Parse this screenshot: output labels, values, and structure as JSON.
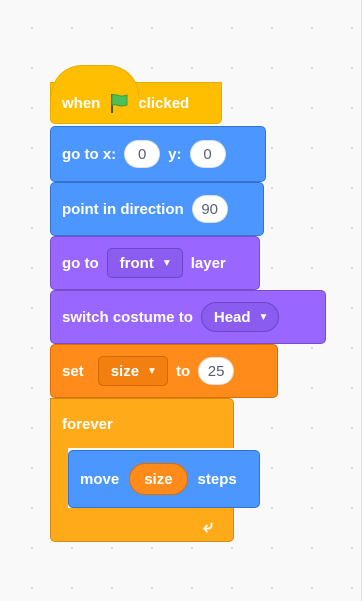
{
  "script": {
    "hat": {
      "label_before": "when",
      "flag_icon": "green-flag-icon",
      "label_after": "clicked"
    },
    "go_to_xy": {
      "label": "go to x:",
      "x_value": "0",
      "y_label": "y:",
      "y_value": "0"
    },
    "point_in_direction": {
      "label": "point in direction",
      "value": "90"
    },
    "go_to_layer": {
      "label": "go to",
      "option": "front",
      "suffix": "layer"
    },
    "switch_costume": {
      "label": "switch costume to",
      "option": "Head"
    },
    "set_variable": {
      "label": "set",
      "variable": "size",
      "to_label": "to",
      "value": "25"
    },
    "forever": {
      "label": "forever",
      "loop_icon": "loop-arrow-icon"
    },
    "move_steps": {
      "label": "move",
      "reporter": "size",
      "suffix": "steps"
    }
  },
  "colors": {
    "events": "#ffbf00",
    "motion": "#4c97ff",
    "looks": "#9966ff",
    "variables": "#ff8c1a",
    "control": "#ffab19"
  }
}
